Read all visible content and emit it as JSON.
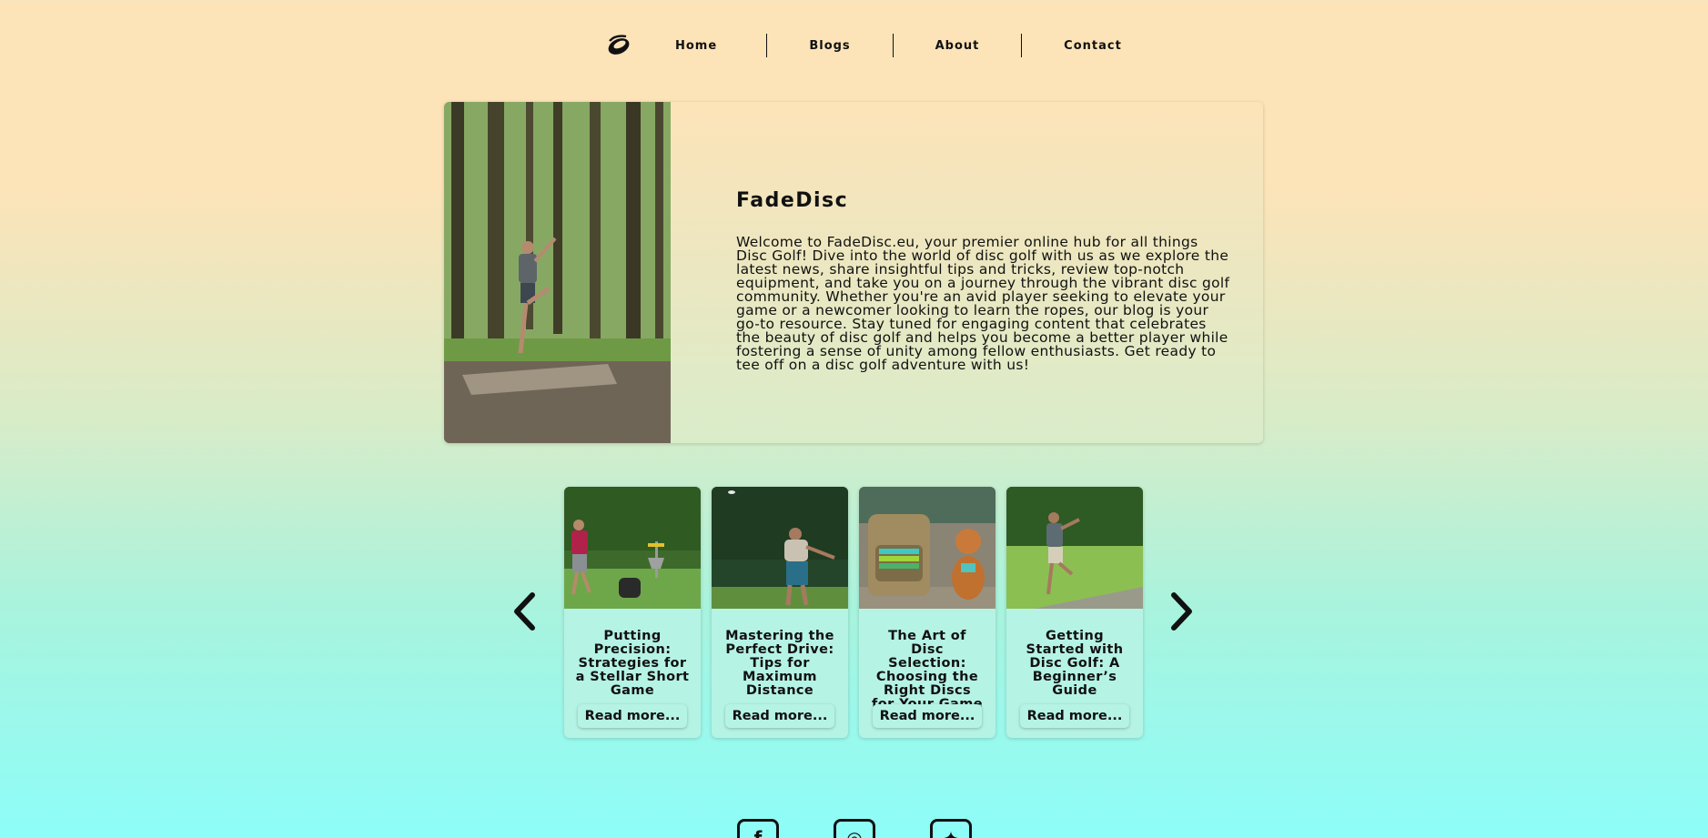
{
  "nav": {
    "items": [
      {
        "label": "Home"
      },
      {
        "label": "Blogs"
      },
      {
        "label": "About"
      },
      {
        "label": "Contact"
      }
    ]
  },
  "hero": {
    "title": "FadeDisc",
    "body": "Welcome to FadeDisc.eu, your premier online hub for all things Disc Golf! Dive into the world of disc golf with us as we explore the latest news, share insightful tips and tricks, review top-notch equipment, and take you on a journey through the vibrant disc golf community. Whether you're an avid player seeking to elevate your game or a newcomer looking to learn the ropes, our blog is your go-to resource. Stay tuned for engaging content that celebrates the beauty of disc golf and helps you become a better player while fostering a sense of unity among fellow enthusiasts. Get ready to tee off on a disc golf adventure with us!"
  },
  "cards": [
    {
      "title": "Putting Precision: Strategies for a Stellar Short Game",
      "button": "Read more..."
    },
    {
      "title": "Mastering the Perfect Drive: Tips for Maximum Distance",
      "button": "Read more..."
    },
    {
      "title": "The Art of Disc Selection: Choosing the Right Discs for Your Game",
      "button": "Read more..."
    },
    {
      "title": "Getting Started with Disc Golf: A Beginner’s Guide",
      "button": "Read more..."
    }
  ],
  "social": [
    {
      "icon": "facebook-icon",
      "glyph": "f"
    },
    {
      "icon": "instagram-icon",
      "glyph": "◎"
    },
    {
      "icon": "twitter-icon",
      "glyph": "✦"
    }
  ],
  "colors": {
    "bg_top": "#fde3b8",
    "bg_bottom": "#8dfdf8",
    "card_bg": "#b5f3e5",
    "text": "#111111"
  }
}
